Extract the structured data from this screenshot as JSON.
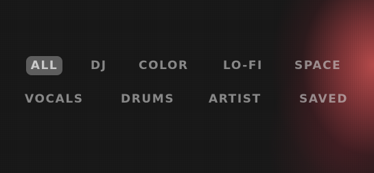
{
  "filters": {
    "row1": [
      "ALL",
      "DJ",
      "COLOR",
      "LO-FI",
      "SPACE"
    ],
    "row2": [
      "VOCALS",
      "DRUMS",
      "ARTIST",
      "SAVED"
    ],
    "selected": "ALL"
  },
  "colors": {
    "background": "#181818",
    "accent_glow": "#be4e4e",
    "selected_chip": "#8a8a8a",
    "chip_text": "#bdbdbd"
  }
}
